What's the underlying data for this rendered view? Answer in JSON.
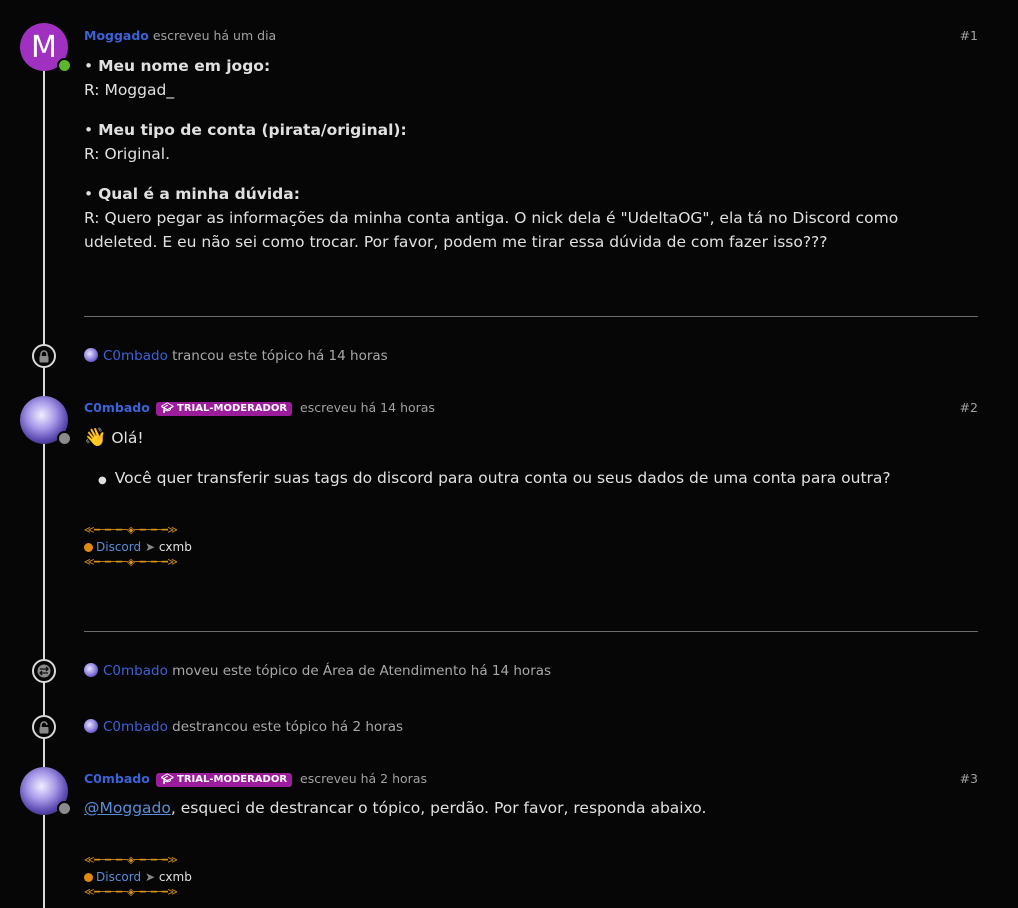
{
  "posts": [
    {
      "avatar_letter": "M",
      "author": "Moggado",
      "action": "escreveu há um dia",
      "number": "#1",
      "status_color": "#5bb82e",
      "q1_label": "Meu nome em jogo:",
      "q1_answer": "R: Moggad_",
      "q2_label": "Meu tipo de conta (pirata/original):",
      "q2_answer": "R: Original.",
      "q3_label": "Qual é a minha dúvida:",
      "q3_answer": "R: Quero pegar as informações da minha conta antiga. O nick dela é \"UdeltaOG\", ela tá no Discord como udeleted. E eu não sei como trocar. Por favor, podem me tirar essa dúvida de com fazer isso???"
    },
    {
      "author": "C0mbado",
      "badge": "TRIAL-MODERADOR",
      "action": "escreveu há 14 horas",
      "number": "#2",
      "greeting": "Olá!",
      "bullet": "Você quer transferir suas tags do discord para outra conta ou seus dados de uma conta para outra?",
      "status_color": "#8a8a8a"
    },
    {
      "author": "C0mbado",
      "badge": "TRIAL-MODERADOR",
      "action": "escreveu há 2 horas",
      "number": "#3",
      "mention": "@Moggado",
      "text": ", esqueci de destrancar o tópico, perdão. Por favor, responda abaixo.",
      "status_color": "#8a8a8a"
    }
  ],
  "events": [
    {
      "icon": "lock-icon",
      "user": "C0mbado",
      "text": "trancou este tópico há 14 horas"
    },
    {
      "icon": "move-icon",
      "user": "C0mbado",
      "text": "moveu este tópico de Área de Atendimento há 14 horas"
    },
    {
      "icon": "unlock-icon",
      "user": "C0mbado",
      "text": "destrancou este tópico há 2 horas"
    }
  ],
  "signature": {
    "ornament": "≪━─━─━─◈─━─━─━≫",
    "link": "Discord",
    "arrow": "➤",
    "handle": "cxmb"
  },
  "colors": {
    "background": "#060606",
    "username": "#3b62d6",
    "badge": "#9b1d9b",
    "ornament": "#d4901a"
  }
}
